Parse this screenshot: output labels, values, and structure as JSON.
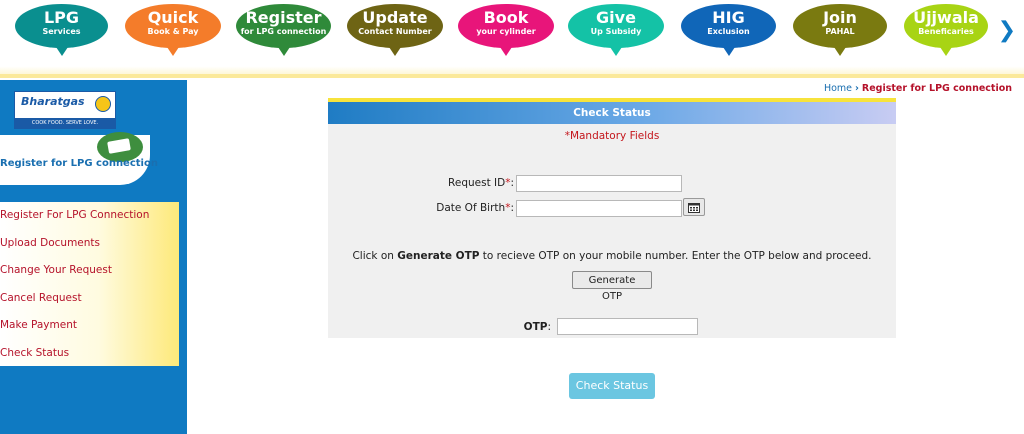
{
  "topnav": {
    "items": [
      {
        "title": "LPG",
        "subtitle": "Services",
        "color": "#0a8f8f"
      },
      {
        "title": "Quick",
        "subtitle": "Book & Pay",
        "color": "#f47c2a"
      },
      {
        "title": "Register",
        "subtitle": "for LPG connection",
        "color": "#2f8a3a"
      },
      {
        "title": "Update",
        "subtitle": "Contact Number",
        "color": "#6e6414"
      },
      {
        "title": "Book",
        "subtitle": "your cylinder",
        "color": "#e8157a"
      },
      {
        "title": "Give",
        "subtitle": "Up Subsidy",
        "color": "#14c2a6"
      },
      {
        "title": "HIG",
        "subtitle": "Exclusion",
        "color": "#1066b8"
      },
      {
        "title": "Join",
        "subtitle": "PAHAL",
        "color": "#7a7a10"
      },
      {
        "title": "Ujjwala",
        "subtitle": "Beneficaries",
        "color": "#a8d414"
      }
    ],
    "next_icon": "chevron-right-icon"
  },
  "sidebar": {
    "logo_text": "Bharatgas",
    "logo_tagline": "COOK FOOD. SERVE LOVE.",
    "banner_title": "Register for LPG connection",
    "menu": [
      "Register For LPG Connection",
      "Upload Documents",
      "Change Your Request",
      "Cancel Request",
      "Make Payment",
      "Check Status"
    ]
  },
  "breadcrumb": {
    "home": "Home",
    "separator": "›",
    "current": "Register for LPG connection"
  },
  "form": {
    "header": "Check Status",
    "mandatory_note": "*Mandatory Fields",
    "request_id_label": "Request ID",
    "dob_label": "Date Of Birth",
    "required_mark": "*",
    "colon": ":",
    "otp_msg_prefix": "Click on ",
    "otp_msg_bold": "Generate OTP",
    "otp_msg_suffix": " to recieve OTP on your mobile number. Enter the OTP below and proceed.",
    "generate_otp_button": "Generate OTP",
    "otp_label": "OTP",
    "request_id_value": "",
    "dob_value": "",
    "otp_value": "",
    "calendar_icon": "calendar-icon"
  },
  "check_status_button": "Check Status"
}
